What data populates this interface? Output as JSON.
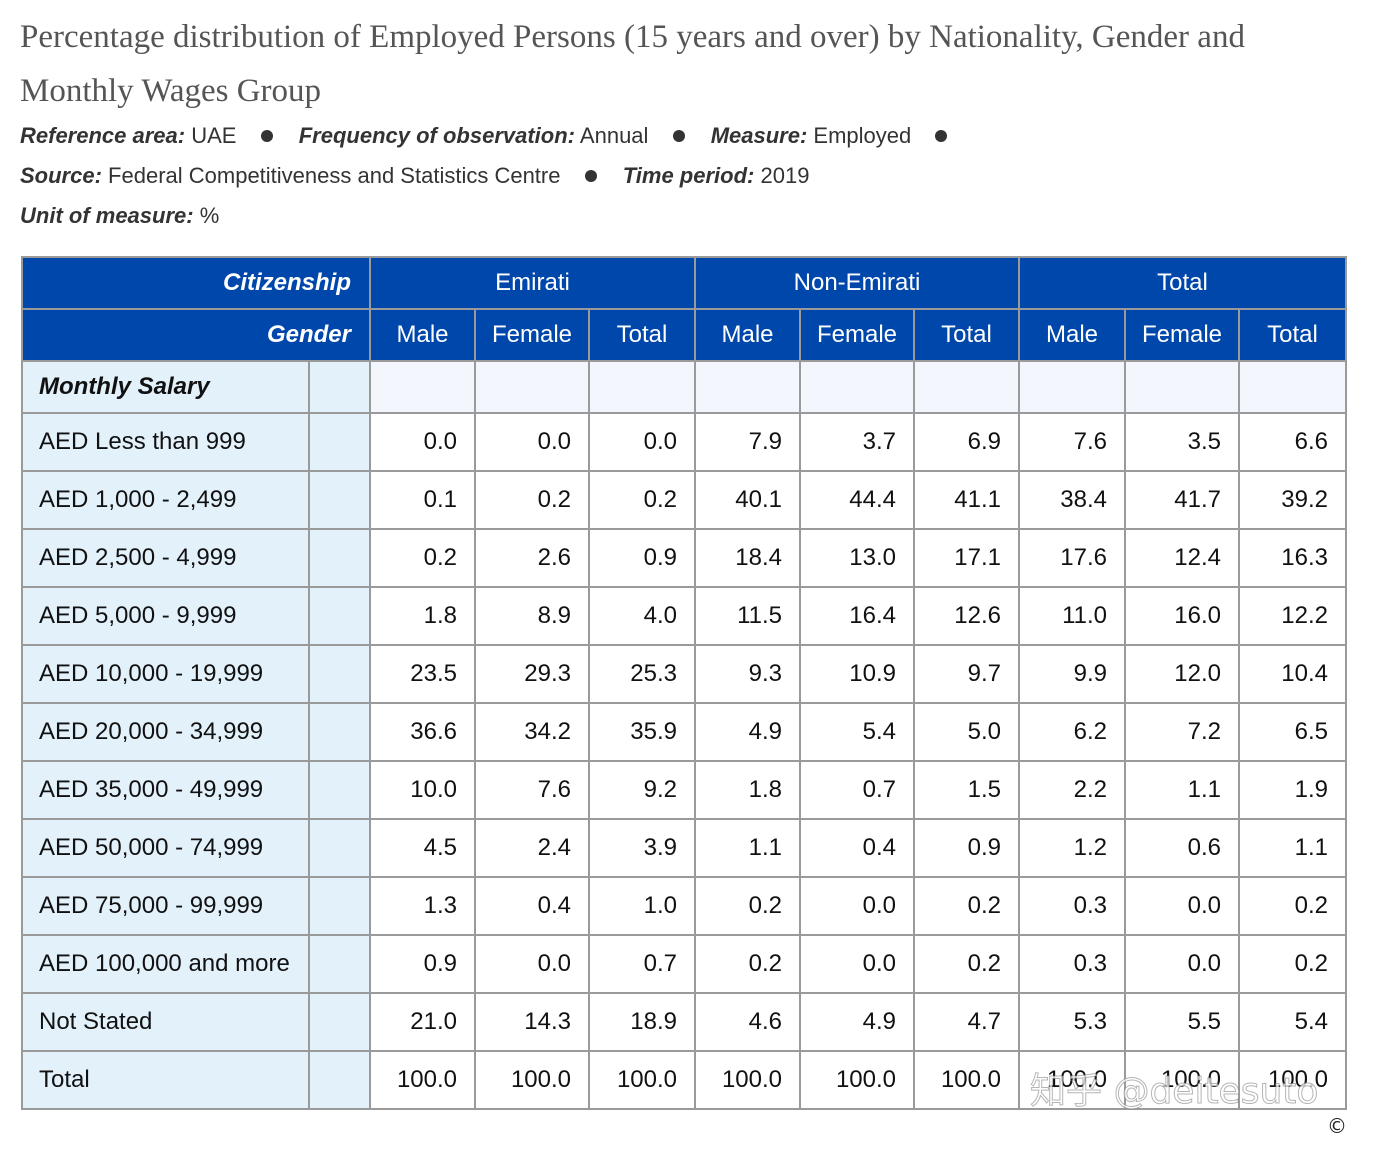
{
  "title": "Percentage distribution of Employed Persons (15 years and over) by Nationality, Gender and Monthly Wages Group",
  "meta": {
    "reference_area_label": "Reference area:",
    "reference_area_value": "UAE",
    "frequency_label": "Frequency of observation:",
    "frequency_value": "Annual",
    "measure_label": "Measure:",
    "measure_value": "Employed",
    "source_label": "Source:",
    "source_value": "Federal Competitiveness and Statistics Centre",
    "time_period_label": "Time period:",
    "time_period_value": "2019",
    "unit_label": "Unit of measure:",
    "unit_value": "%"
  },
  "table": {
    "citizenship_label": "Citizenship",
    "gender_label": "Gender",
    "groups": [
      "Emirati",
      "Non-Emirati",
      "Total"
    ],
    "genders": [
      "Male",
      "Female",
      "Total",
      "Male",
      "Female",
      "Total",
      "Male",
      "Female",
      "Total"
    ],
    "monthly_salary_label": "Monthly Salary",
    "rows": [
      {
        "label": "AED Less than 999",
        "values": [
          "0.0",
          "0.0",
          "0.0",
          "7.9",
          "3.7",
          "6.9",
          "7.6",
          "3.5",
          "6.6"
        ]
      },
      {
        "label": "AED 1,000 - 2,499",
        "values": [
          "0.1",
          "0.2",
          "0.2",
          "40.1",
          "44.4",
          "41.1",
          "38.4",
          "41.7",
          "39.2"
        ]
      },
      {
        "label": "AED 2,500 - 4,999",
        "values": [
          "0.2",
          "2.6",
          "0.9",
          "18.4",
          "13.0",
          "17.1",
          "17.6",
          "12.4",
          "16.3"
        ]
      },
      {
        "label": "AED 5,000 - 9,999",
        "values": [
          "1.8",
          "8.9",
          "4.0",
          "11.5",
          "16.4",
          "12.6",
          "11.0",
          "16.0",
          "12.2"
        ]
      },
      {
        "label": "AED 10,000 - 19,999",
        "values": [
          "23.5",
          "29.3",
          "25.3",
          "9.3",
          "10.9",
          "9.7",
          "9.9",
          "12.0",
          "10.4"
        ]
      },
      {
        "label": "AED 20,000 - 34,999",
        "values": [
          "36.6",
          "34.2",
          "35.9",
          "4.9",
          "5.4",
          "5.0",
          "6.2",
          "7.2",
          "6.5"
        ]
      },
      {
        "label": "AED 35,000 - 49,999",
        "values": [
          "10.0",
          "7.6",
          "9.2",
          "1.8",
          "0.7",
          "1.5",
          "2.2",
          "1.1",
          "1.9"
        ]
      },
      {
        "label": "AED 50,000 - 74,999",
        "values": [
          "4.5",
          "2.4",
          "3.9",
          "1.1",
          "0.4",
          "0.9",
          "1.2",
          "0.6",
          "1.1"
        ]
      },
      {
        "label": "AED 75,000 - 99,999",
        "values": [
          "1.3",
          "0.4",
          "1.0",
          "0.2",
          "0.0",
          "0.2",
          "0.3",
          "0.0",
          "0.2"
        ]
      },
      {
        "label": "AED 100,000 and more",
        "values": [
          "0.9",
          "0.0",
          "0.7",
          "0.2",
          "0.0",
          "0.2",
          "0.3",
          "0.0",
          "0.2"
        ]
      },
      {
        "label": "Not Stated",
        "values": [
          "21.0",
          "14.3",
          "18.9",
          "4.6",
          "4.9",
          "4.7",
          "5.3",
          "5.5",
          "5.4"
        ]
      },
      {
        "label": "Total",
        "values": [
          "100.0",
          "100.0",
          "100.0",
          "100.0",
          "100.0",
          "100.0",
          "100.0",
          "100.0",
          "100.0"
        ]
      }
    ]
  },
  "watermark": "知乎 @deitesuto",
  "copyright": "©",
  "colors": {
    "header_bg": "#0047ab",
    "side_bg": "#e3f1fb",
    "grid": "#9a9a9a"
  }
}
